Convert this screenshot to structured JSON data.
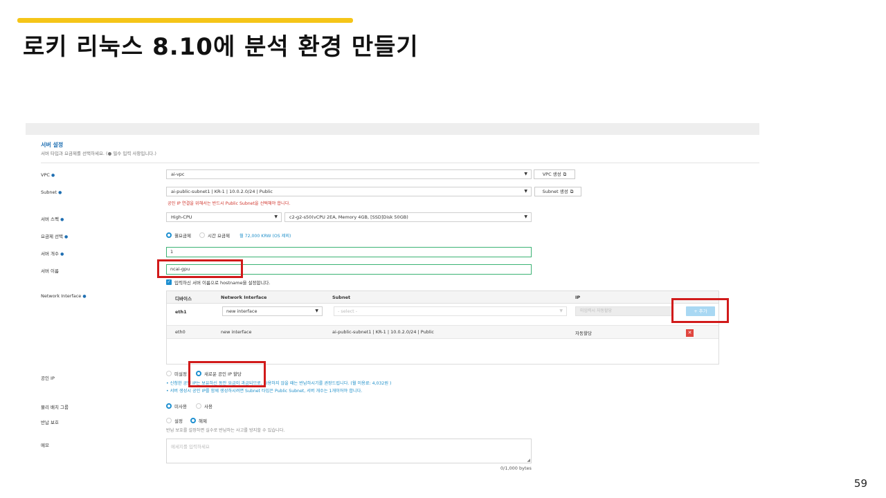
{
  "slide": {
    "title": "로키 리눅스 8.10에 분석 환경 만들기",
    "page_number": "59",
    "accent_color": "#f5c518"
  },
  "form": {
    "section_title": "서버 설정",
    "section_desc": "서버 타입과 요금제를 선택하세요. (● 필수 입력 사항입니다.)",
    "vpc": {
      "label": "VPC",
      "value": "ai-vpc",
      "create_button": "VPC 생성"
    },
    "subnet": {
      "label": "Subnet",
      "value": "ai-public-subnet1 | KR-1 | 10.0.2.0/24 | Public",
      "create_button": "Subnet 생성",
      "warning": "공인 IP 연결을 위해서는 반드시 Public Subnet을 선택해야 합니다."
    },
    "server_spec": {
      "label": "서버 스펙",
      "type_value": "High-CPU",
      "spec_value": "c2-g2-s50(vCPU 2EA, Memory 4GB, [SSD]Disk 50GB)"
    },
    "pricing": {
      "label": "요금제 선택",
      "options": [
        "월요금제",
        "시간 요금제"
      ],
      "selected": "월요금제",
      "price": "월 72,000 KRW (OS 제외)"
    },
    "server_count": {
      "label": "서버 개수",
      "value": "1"
    },
    "server_name": {
      "label": "서버 이름",
      "value": "ncai-gpu",
      "checkbox_label": "입력하신 서버 이름으로 hostname을 설정합니다."
    },
    "network_interface": {
      "label": "Network Interface",
      "columns": [
        "디바이스",
        "Network Interface",
        "Subnet",
        "IP"
      ],
      "new_row": {
        "device": "eth1",
        "interface_value": "new interface",
        "subnet_placeholder": "- select -",
        "ip_placeholder": "미입력시 자동할당",
        "add_button": "+ 추가"
      },
      "rows": [
        {
          "device": "eth0",
          "interface": "new interface",
          "subnet": "ai-public-subnet1 | KR-1 | 10.0.2.0/24 | Public",
          "ip": "자동할당"
        }
      ]
    },
    "public_ip": {
      "label": "공인 IP",
      "options": [
        "미설정",
        "새로운 공인 IP 할당"
      ],
      "selected": "새로운 공인 IP 할당",
      "notes": [
        "• 신청한 공인 IP는 보유하신 동안 요금이 과금되므로, 사용하지 않을 때는 반납하시기를 권장드립니다. (월 이용료: 4,032원 )",
        "• 서버 생성시 공인 IP를 함께 생성하시려면 Subnet 타입은 Public Subnet, 서버 개수는 1개이어야 합니다."
      ]
    },
    "physical_placement": {
      "label": "물리 배치 그룹",
      "options": [
        "미사용",
        "사용"
      ],
      "selected": "미사용"
    },
    "return_protection": {
      "label": "반납 보호",
      "options": [
        "설정",
        "해제"
      ],
      "selected": "해제",
      "note": "반납 보호를 설정하면 실수로 반납하는 사고를 방지할 수 있습니다."
    },
    "memo": {
      "label": "메모",
      "placeholder": "메세지를 입력하세요",
      "byte_count": "0/1,000 bytes"
    }
  }
}
